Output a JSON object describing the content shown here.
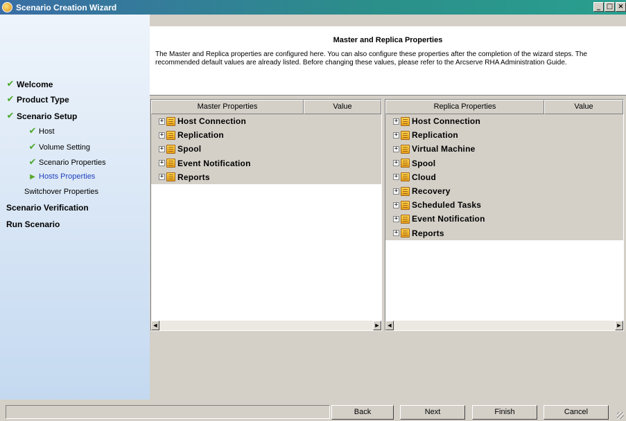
{
  "window": {
    "title": "Scenario Creation Wizard",
    "controls": [
      "_",
      "□",
      "×"
    ]
  },
  "sidebar": {
    "steps": [
      {
        "label": "Welcome",
        "status": "done",
        "level": "major"
      },
      {
        "label": "Product Type",
        "status": "done",
        "level": "major"
      },
      {
        "label": "Scenario Setup",
        "status": "done",
        "level": "major"
      },
      {
        "label": "Host",
        "status": "done",
        "level": "minor"
      },
      {
        "label": "Volume Setting",
        "status": "done",
        "level": "minor"
      },
      {
        "label": "Scenario Properties",
        "status": "done",
        "level": "minor"
      },
      {
        "label": "Hosts Properties",
        "status": "current",
        "level": "minor"
      },
      {
        "label": "Switchover Properties",
        "status": "pending",
        "level": "minor"
      },
      {
        "label": "Scenario Verification",
        "status": "pending",
        "level": "major"
      },
      {
        "label": "Run Scenario",
        "status": "pending",
        "level": "major"
      }
    ]
  },
  "header": {
    "title": "Master and Replica Properties",
    "description": "The Master and Replica properties are configured here. You can also configure these properties after the completion of the wizard steps. The recommended default values are already listed. Before changing these values, please refer to the Arcserve RHA Administration Guide."
  },
  "master": {
    "col_property": "Master Properties",
    "col_value": "Value",
    "items": [
      "Host Connection",
      "Replication",
      "Spool",
      "Event Notification",
      "Reports"
    ]
  },
  "replica": {
    "col_property": "Replica Properties",
    "col_value": "Value",
    "items": [
      "Host Connection",
      "Replication",
      "Virtual Machine",
      "Spool",
      "Cloud",
      "Recovery",
      "Scheduled Tasks",
      "Event Notification",
      "Reports"
    ]
  },
  "footer": {
    "back": "Back",
    "next": "Next",
    "finish": "Finish",
    "cancel": "Cancel"
  },
  "colors": {
    "title_bar": "#3a6ea5",
    "done_check": "#4aa82a",
    "current_step_text": "#2040c0"
  }
}
